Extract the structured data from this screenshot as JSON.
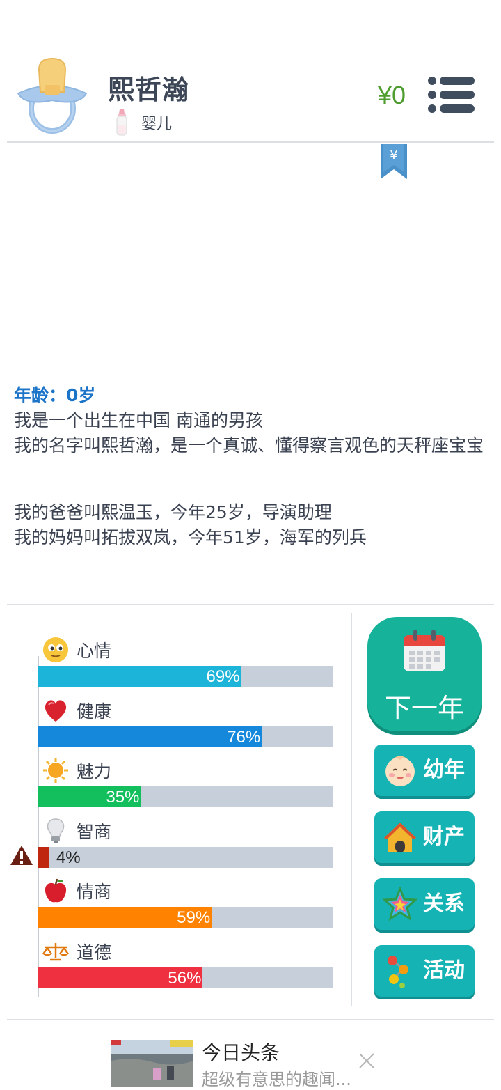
{
  "header": {
    "name": "熙哲瀚",
    "stage_label": "婴儿",
    "money": "¥0",
    "avatar_icon": "pacifier-icon",
    "stage_icon": "baby-bottle-icon",
    "menu_icon": "menu-list-icon",
    "bookmark_icon": "yuan-bookmark-icon",
    "bookmark_symbol": "¥"
  },
  "story": {
    "age": "年龄：0岁",
    "lines": [
      "我是一个出生在中国 南通的男孩",
      "我的名字叫熙哲瀚，是一个真诚、懂得察言观色的天秤座宝宝",
      "我的爸爸叫熙温玉，今年25岁，导演助理",
      "我的妈妈叫拓拔双岚，今年51岁，海军的列兵"
    ]
  },
  "stats": [
    {
      "label": "心情",
      "value": 69,
      "pct": "69%",
      "color": "#1cb4d9",
      "icon": "smiley-face-icon"
    },
    {
      "label": "健康",
      "value": 76,
      "pct": "76%",
      "color": "#1688db",
      "icon": "heart-icon"
    },
    {
      "label": "魅力",
      "value": 35,
      "pct": "35%",
      "color": "#12bf5c",
      "icon": "sun-icon"
    },
    {
      "label": "智商",
      "value": 4,
      "pct": "4%",
      "color": "#c0270f",
      "icon": "lightbulb-icon",
      "warning": true
    },
    {
      "label": "情商",
      "value": 59,
      "pct": "59%",
      "color": "#ff8200",
      "icon": "apple-icon"
    },
    {
      "label": "道德",
      "value": 56,
      "pct": "56%",
      "color": "#ef3040",
      "icon": "scales-icon"
    }
  ],
  "actions": {
    "next_year": "下一年",
    "buttons": [
      {
        "label": "幼年",
        "icon": "baby-face-icon"
      },
      {
        "label": "财产",
        "icon": "house-icon"
      },
      {
        "label": "关系",
        "icon": "star-icon"
      },
      {
        "label": "活动",
        "icon": "molecule-icon"
      }
    ]
  },
  "ad": {
    "title": "今日头条",
    "desc": "超级有意思的趣闻...",
    "thumb_icon": "news-photo-thumbnail",
    "close_icon": "close-icon"
  },
  "colors": {
    "accent_green": "#16b39a",
    "accent_teal": "#16b3b4",
    "money_green": "#4f9d2f",
    "age_blue": "#1c74c9"
  }
}
